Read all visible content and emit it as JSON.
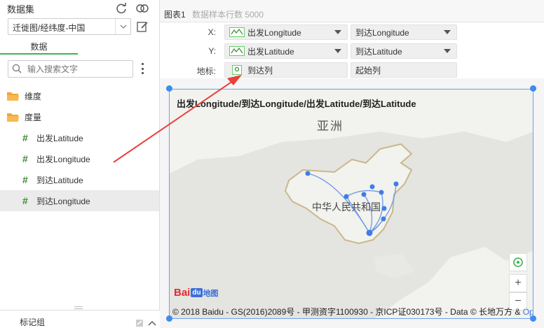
{
  "left": {
    "dataset_label": "数据集",
    "dataset_value": "迁徙图/经纬度-中国",
    "tab_data": "数据",
    "search_placeholder": "输入搜索文字",
    "folders": [
      "维度",
      "度量"
    ],
    "fields": [
      "出发Latitude",
      "出发Longitude",
      "到达Latitude",
      "到达Longitude"
    ],
    "marks_label": "标记组",
    "icons": [
      "refresh-icon",
      "link-icon",
      "edit-icon",
      "search-icon",
      "more-icon",
      "folder-icon",
      "collapse-icon"
    ]
  },
  "right": {
    "chart_tab": "图表1",
    "sample_count": "数据样本行数 5000",
    "shelves": {
      "x_label": "X:",
      "y_label": "Y:",
      "mark_label": "地标:",
      "x_pills": [
        "出发Longitude",
        "到达Longitude"
      ],
      "y_pills": [
        "出发Latitude",
        "到达Latitude"
      ],
      "mark_pills": [
        "到达列",
        "起始列"
      ]
    },
    "chart": {
      "heading": "出发Longitude/到达Longitude/出发Latitude/到达Latitude",
      "continent": "亚洲",
      "country": "中华人民共和国",
      "copyright": "© 2018 Baidu - GS(2016)2089号 - 甲测资字1100930 - 京ICP证030173号 - Data © 长地万方 &",
      "copyright_tail": "Op",
      "zoom_in": "+",
      "zoom_out": "−",
      "baidu_logo_text": [
        "Bai",
        "du",
        "地图"
      ]
    }
  },
  "colors": {
    "accent_green": "#3fb34f",
    "selection_blue": "#3f8bf0",
    "arrow_red": "#e8403c",
    "route_blue": "#6f97e6"
  }
}
